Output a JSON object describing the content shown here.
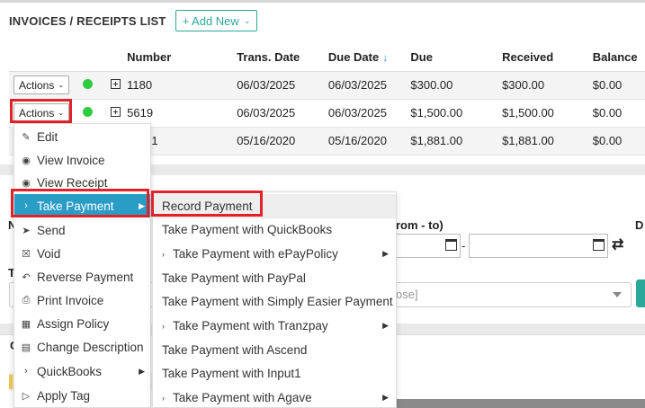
{
  "header": {
    "title": "INVOICES / RECEIPTS LIST",
    "add_new_label": "+ Add New"
  },
  "table": {
    "columns": [
      "Number",
      "Trans. Date",
      "Due Date",
      "Due",
      "Received",
      "Balance"
    ],
    "sort_arrow": "↓",
    "rows": [
      {
        "actions_label": "Actions",
        "number": "1180",
        "trans_date": "06/03/2025",
        "due_date": "06/03/2025",
        "due": "$300.00",
        "received": "$300.00",
        "balance": "$0.00"
      },
      {
        "actions_label": "Actions",
        "number": "5619",
        "trans_date": "06/03/2025",
        "due_date": "06/03/2025",
        "due": "$1,500.00",
        "received": "$1,500.00",
        "balance": "$0.00"
      },
      {
        "actions_label": "",
        "number": "71",
        "trans_date": "05/16/2020",
        "due_date": "05/16/2020",
        "due": "$1,881.00",
        "received": "$1,881.00",
        "balance": "$0.00"
      }
    ]
  },
  "filters": {
    "range_label": "rom - to)",
    "d_label": "D",
    "n_label": "N",
    "t_label": "T",
    "dash": "-",
    "select_placeholder": "ose]",
    "c_label": "C"
  },
  "actions_menu": {
    "items": [
      {
        "label": "Edit",
        "icon": "edit-icon"
      },
      {
        "label": "View Invoice",
        "icon": "eye-icon"
      },
      {
        "label": "View Receipt",
        "icon": "eye-icon"
      },
      {
        "label": "Take Payment",
        "icon": "chevron-right-icon",
        "submenu": true,
        "active": true
      },
      {
        "label": "Send",
        "icon": "send-icon"
      },
      {
        "label": "Void",
        "icon": "void-icon"
      },
      {
        "label": "Reverse Payment",
        "icon": "undo-icon"
      },
      {
        "label": "Print Invoice",
        "icon": "print-icon"
      },
      {
        "label": "Assign Policy",
        "icon": "policy-icon"
      },
      {
        "label": "Change Description",
        "icon": "description-icon"
      },
      {
        "label": "QuickBooks",
        "icon": "chevron-right-icon",
        "submenu": true
      },
      {
        "label": "Apply Tag",
        "icon": "tag-icon"
      }
    ]
  },
  "take_payment_submenu": {
    "items": [
      {
        "label": "Record Payment",
        "submenu": false
      },
      {
        "label": "Take Payment with QuickBooks",
        "submenu": false
      },
      {
        "label": "Take Payment with ePayPolicy",
        "submenu": true
      },
      {
        "label": "Take Payment with PayPal",
        "submenu": false
      },
      {
        "label": "Take Payment with Simply Easier Payment",
        "submenu": false
      },
      {
        "label": "Take Payment with Tranzpay",
        "submenu": true
      },
      {
        "label": "Take Payment with Ascend",
        "submenu": false
      },
      {
        "label": "Take Payment with Input1",
        "submenu": false
      },
      {
        "label": "Take Payment with Agave",
        "submenu": true
      }
    ]
  },
  "colors": {
    "accent": "#2aa89a",
    "menu_active": "#2a9dc7",
    "highlight": "#e2222b",
    "status_dot": "#2ecc40",
    "sort_arrow": "#2b8fd6"
  }
}
